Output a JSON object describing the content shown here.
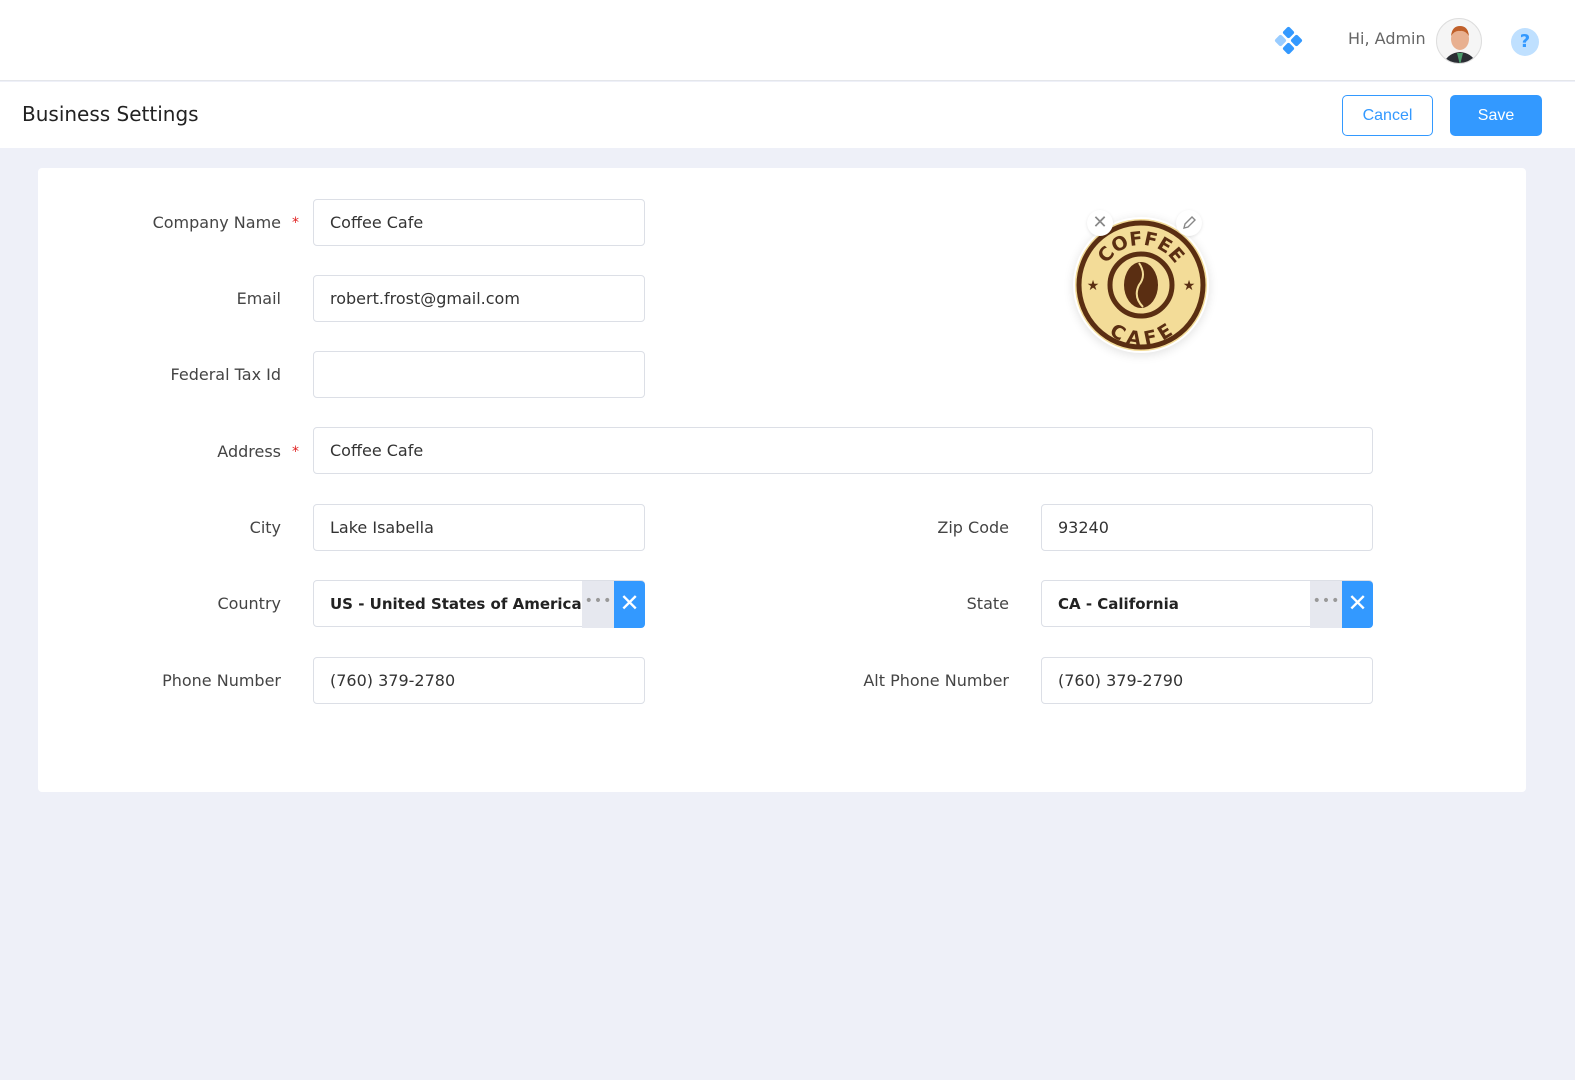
{
  "header": {
    "greeting": "Hi, Admin",
    "help_label": "?"
  },
  "page": {
    "title": "Business Settings",
    "cancel_label": "Cancel",
    "save_label": "Save"
  },
  "logo": {
    "top_text": "COFFEE",
    "bottom_text": "CAFE"
  },
  "form": {
    "company_name": {
      "label": "Company Name",
      "value": "Coffee Cafe",
      "required": true
    },
    "email": {
      "label": "Email",
      "value": "robert.frost@gmail.com"
    },
    "federal_tax_id": {
      "label": "Federal Tax Id",
      "value": ""
    },
    "address": {
      "label": "Address",
      "value": "Coffee Cafe",
      "required": true
    },
    "city": {
      "label": "City",
      "value": "Lake Isabella"
    },
    "zip_code": {
      "label": "Zip Code",
      "value": "93240"
    },
    "country": {
      "label": "Country",
      "value": "US - United States of America"
    },
    "state": {
      "label": "State",
      "value": "CA - California"
    },
    "phone_number": {
      "label": "Phone Number",
      "value": "(760) 379-2780"
    },
    "alt_phone_number": {
      "label": "Alt Phone Number",
      "value": "(760) 379-2790"
    }
  },
  "symbols": {
    "required": "*",
    "more": "•••",
    "clear": "✕"
  },
  "colors": {
    "accent": "#3399ff",
    "required": "#e02020",
    "background": "#eef0f8"
  }
}
